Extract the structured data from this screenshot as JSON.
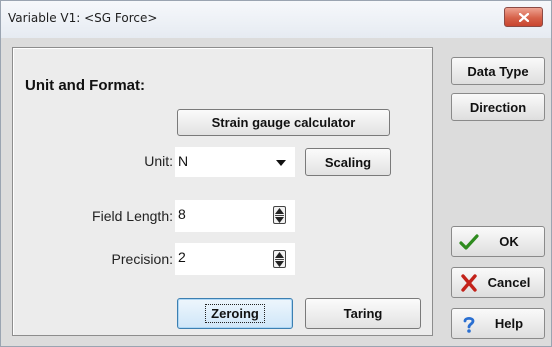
{
  "window": {
    "title": "Variable V1: <SG Force>"
  },
  "panel": {
    "section_title": "Unit and Format:",
    "strain_gauge_button": "Strain gauge calculator",
    "unit_label": "Unit:",
    "unit_value": "N",
    "scaling_button": "Scaling",
    "field_length_label": "Field Length:",
    "field_length_value": "8",
    "precision_label": "Precision:",
    "precision_value": "2",
    "zeroing_button": "Zeroing",
    "taring_button": "Taring"
  },
  "side": {
    "data_type_button": "Data Type",
    "direction_button": "Direction",
    "ok_button": "OK",
    "cancel_button": "Cancel",
    "help_button": "Help"
  },
  "colors": {
    "ok_icon": "#2e8b1e",
    "cancel_icon": "#c3221a",
    "help_icon": "#2a6fd1",
    "close_button": "#d6624a"
  }
}
